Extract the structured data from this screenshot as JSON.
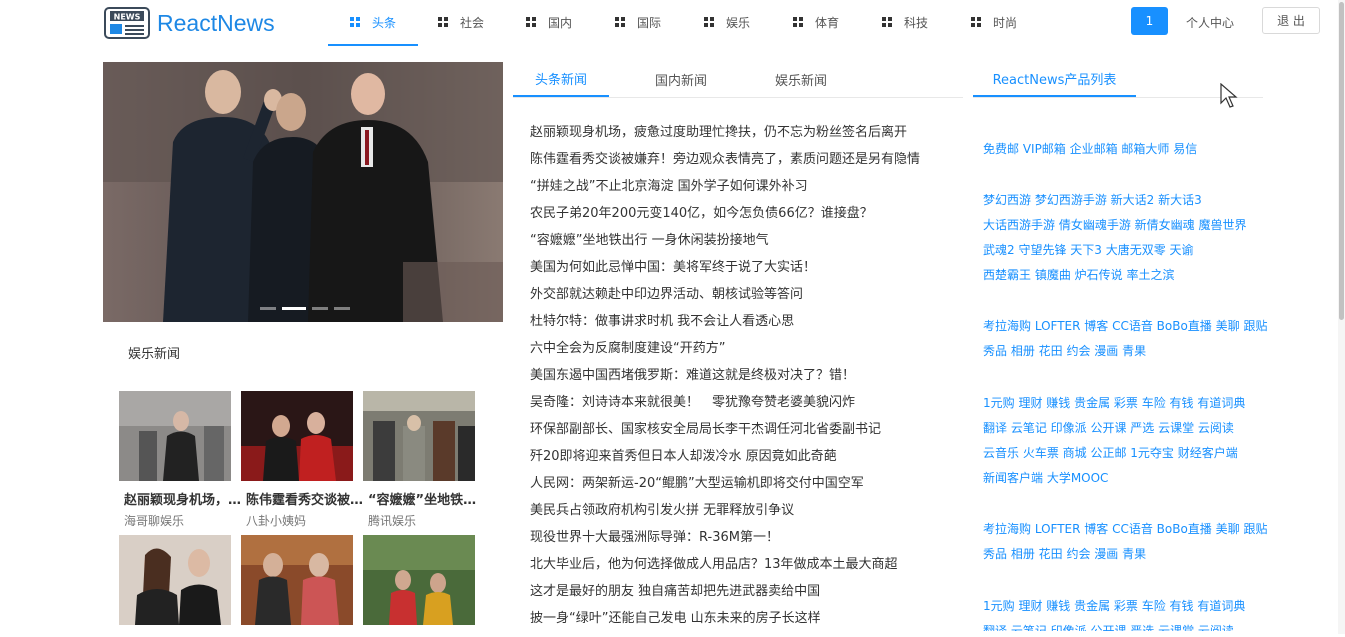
{
  "header": {
    "logo_text": "ReactNews",
    "nav": [
      {
        "label": "头条",
        "active": true
      },
      {
        "label": "社会",
        "active": false
      },
      {
        "label": "国内",
        "active": false
      },
      {
        "label": "国际",
        "active": false
      },
      {
        "label": "娱乐",
        "active": false
      },
      {
        "label": "体育",
        "active": false
      },
      {
        "label": "科技",
        "active": false
      },
      {
        "label": "时尚",
        "active": false
      }
    ],
    "badge": "1",
    "user_center": "个人中心",
    "logout": "退 出"
  },
  "entertainment": {
    "title": "娱乐新闻",
    "cards": [
      {
        "title": "赵丽颖现身机场，疲惫过度助理忙搀扶",
        "source": "海哥聊娱乐"
      },
      {
        "title": "陈伟霆看秀交谈被嫌弃！旁边观众表情亮了",
        "source": "八卦小姨妈"
      },
      {
        "title": "“容嬷嬷”坐地铁出行 一身休闲装扮接地气",
        "source": "腾讯娱乐"
      },
      {
        "title": "",
        "source": ""
      },
      {
        "title": "",
        "source": ""
      },
      {
        "title": "",
        "source": ""
      }
    ]
  },
  "news_tabs": [
    "头条新闻",
    "国内新闻",
    "娱乐新闻"
  ],
  "news_list": [
    "赵丽颖现身机场，疲惫过度助理忙搀扶，仍不忘为粉丝签名后离开",
    "陈伟霆看秀交谈被嫌弃！旁边观众表情亮了，素质问题还是另有隐情",
    "“拼娃之战”不止北京海淀 国外学子如何课外补习",
    "农民子弟20年200元变140亿，如今怎负债66亿？谁接盘？",
    "“容嬷嬷”坐地铁出行 一身休闲装扮接地气",
    "美国为何如此忌惮中国：美将军终于说了大实话！",
    "外交部就达赖赴中印边界活动、朝核试验等答问",
    "杜特尔特：做事讲求时机 我不会让人看透心思",
    "六中全会为反腐制度建设“开药方”",
    "美国东遏中国西堵俄罗斯：难道这就是终极对决了？错！",
    "吴奇隆：刘诗诗本来就很美！　零犹豫夸赞老婆美貌闪炸",
    "环保部副部长、国家核安全局局长李干杰调任河北省委副书记",
    "歼20即将迎来首秀但日本人却泼冷水 原因竟如此奇葩",
    "人民网：两架新运-20“鲲鹏”大型运输机即将交付中国空军",
    "美民兵占领政府机构引发火拼 无罪释放引争议",
    "现役世界十大最强洲际导弹：R-36M第一！",
    "北大毕业后，他为何选择做成人用品店？13年做成本土最大商超",
    "这才是最好的朋友 独自痛苦却把先进武器卖给中国",
    "披一身“绿叶”还能自己发电 山东未来的房子长这样"
  ],
  "products": {
    "tab": "ReactNews产品列表",
    "groups": [
      [
        "免费邮 VIP邮箱 企业邮箱 邮箱大师 易信"
      ],
      [
        "梦幻西游 梦幻西游手游 新大话2 新大话3",
        "大话西游手游 倩女幽魂手游 新倩女幽魂 魔兽世界",
        "武魂2 守望先锋 天下3 大唐无双零 天谕",
        "西楚霸王 镇魔曲 炉石传说 率土之滨"
      ],
      [
        "考拉海购 LOFTER 博客 CC语音 BoBo直播 美聊 跟贴",
        "秀品 相册 花田 约会 漫画 青果"
      ],
      [
        "1元购 理财 赚钱 贵金属 彩票 车险 有钱 有道词典",
        "翻译 云笔记 印像派 公开课 严选 云课堂 云阅读",
        "云音乐 火车票 商城 公正邮 1元夺宝 财经客户端",
        "新闻客户端 大学MOOC"
      ],
      [
        "考拉海购 LOFTER 博客 CC语音 BoBo直播 美聊 跟贴",
        "秀品 相册 花田 约会 漫画 青果"
      ],
      [
        "1元购 理财 赚钱 贵金属 彩票 车险 有钱 有道词典",
        "翻译 云笔记 印像派 公开课 严选 云课堂 云阅读"
      ]
    ]
  },
  "colors": {
    "accent": "#1890ff",
    "logo": "#1e88e5"
  }
}
